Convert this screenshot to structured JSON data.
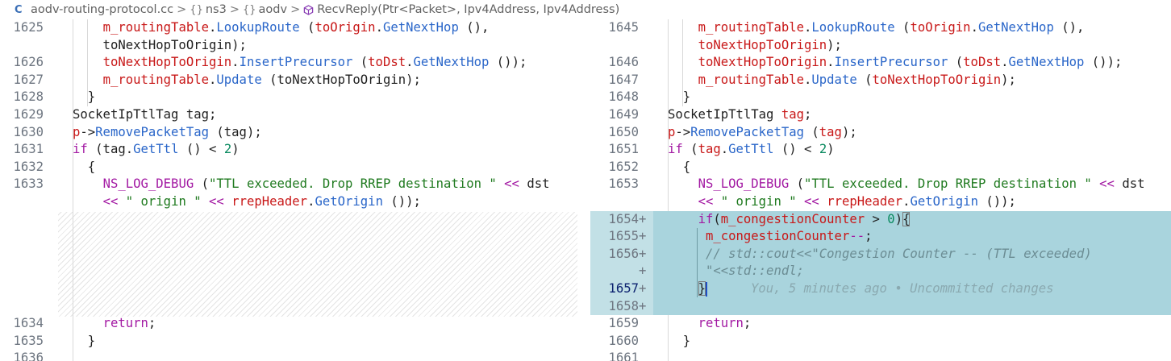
{
  "breadcrumb": {
    "file": "aodv-routing-protocol.cc",
    "ns1": "ns3",
    "ns2": "aodv",
    "method": "RecvReply(Ptr<Packet>, Ipv4Address, Ipv4Address)",
    "separator": ">",
    "namespace_glyph": "{}"
  },
  "left": {
    "line_numbers": [
      "1625",
      "",
      "1626",
      "1627",
      "1628",
      "1629",
      "1630",
      "1631",
      "1632",
      "1633",
      "",
      "1634",
      "1635",
      "1636"
    ]
  },
  "right": {
    "line_numbers": [
      "1645",
      "",
      "1646",
      "1647",
      "1648",
      "1649",
      "1650",
      "1651",
      "1652",
      "1653",
      "",
      "1654",
      "1655",
      "1656",
      "",
      "1657",
      "1658",
      "1659",
      "1660",
      "1661"
    ],
    "added_marker": "+",
    "blame": "You, 5 minutes ago • Uncommitted changes",
    "comment_1": "// std::cout<<\"Congestion Counter -- (TTL exceeded)",
    "comment_2": "\"<<std::endl;"
  },
  "colors": {
    "added_bg": "#a9d4dd",
    "added_gutter_bg": "#c2e0e6",
    "field": "#c81818",
    "function": "#2a66c9",
    "keyword": "#a31aa3",
    "number": "#0a8a5f",
    "string": "#1f7a1f"
  },
  "icons": [
    "c-file-icon",
    "namespace-icon",
    "method-icon"
  ]
}
